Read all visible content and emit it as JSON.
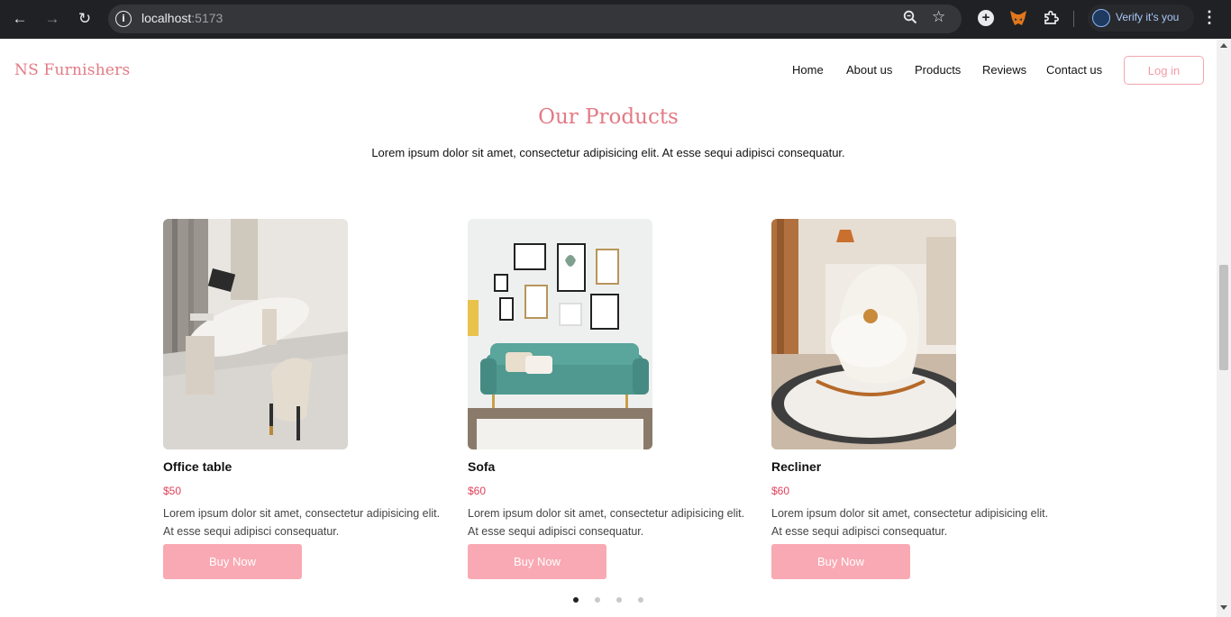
{
  "browser": {
    "url_host": "localhost",
    "url_port": ":5173",
    "profile_label": "Verify it's you"
  },
  "nav": {
    "brand": "NS Furnishers",
    "links": [
      "Home",
      "About us",
      "Products",
      "Reviews",
      "Contact us"
    ],
    "login_label": "Log in"
  },
  "section": {
    "title": "Our Products",
    "subtitle": "Lorem ipsum dolor sit amet, consectetur adipisicing elit. At esse sequi adipisci consequatur."
  },
  "products": [
    {
      "name": "Office table",
      "price": "$50",
      "description": "Lorem ipsum dolor sit amet, consectetur adipisicing elit. At esse sequi adipisci consequatur.",
      "button": "Buy Now"
    },
    {
      "name": "Sofa",
      "price": "$60",
      "description": "Lorem ipsum dolor sit amet, consectetur adipisicing elit. At esse sequi adipisci consequatur.",
      "button": "Buy Now"
    },
    {
      "name": "Recliner",
      "price": "$60",
      "description": "Lorem ipsum dolor sit amet, consectetur adipisicing elit. At esse sequi adipisci consequatur.",
      "button": "Buy Now"
    }
  ],
  "carousel": {
    "active_page": 1,
    "page_count": 4
  },
  "colors": {
    "brand": "#e37a85",
    "button": "#f9a9b3",
    "price": "#e0405a"
  }
}
